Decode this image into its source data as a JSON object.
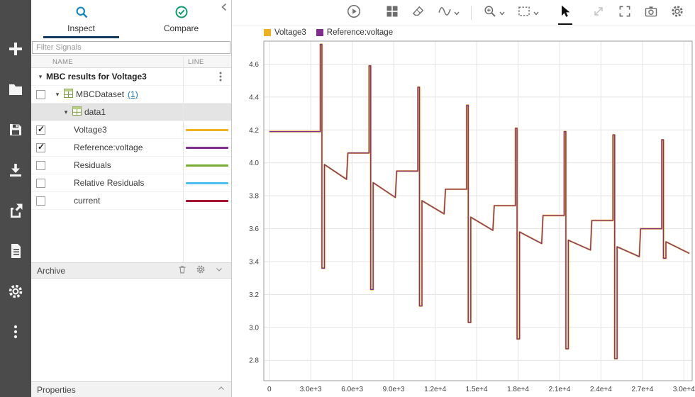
{
  "left_toolbar": {
    "buttons": [
      {
        "label": "new"
      },
      {
        "label": "open"
      },
      {
        "label": "save"
      },
      {
        "label": "import"
      },
      {
        "label": "export"
      },
      {
        "label": "create-report"
      },
      {
        "label": "preferences"
      },
      {
        "label": "more-options"
      }
    ]
  },
  "sidebar": {
    "tabs": [
      {
        "label": "Inspect",
        "selected": true
      },
      {
        "label": "Compare",
        "selected": false
      }
    ],
    "filter_placeholder": "Filter Signals",
    "columns": [
      "NAME",
      "LINE"
    ],
    "tree": {
      "group_label": "MBC results for Voltage3",
      "dataset_label": "MBCDataset",
      "dataset_count_link": "(1)",
      "run_label": "data1",
      "signals": [
        {
          "name": "Voltage3",
          "checked": true,
          "color": "#EDB120"
        },
        {
          "name": "Reference:voltage",
          "checked": true,
          "color": "#7E2F8E"
        },
        {
          "name": "Residuals",
          "checked": false,
          "color": "#77AC30"
        },
        {
          "name": "Relative Residuals",
          "checked": false,
          "color": "#4DBEEE"
        },
        {
          "name": "current",
          "checked": false,
          "color": "#A2142F"
        }
      ]
    },
    "archive_label": "Archive",
    "properties_label": "Properties"
  },
  "accent_colors": {
    "inspect_icon_blue": "#1786c0",
    "compare_icon_green": "#0f9d6a",
    "tab_underline": "#15395b"
  },
  "chart_data": {
    "type": "line",
    "title": "",
    "xlabel": "",
    "ylabel": "",
    "grid": true,
    "legend_position": "top-left",
    "xlim": [
      -400,
      30600
    ],
    "ylim": [
      2.676,
      4.74
    ],
    "x_ticks": [
      0,
      3000,
      6000,
      9000,
      12000,
      15000,
      18000,
      21000,
      24000,
      27000,
      30000
    ],
    "x_tick_labels": [
      "0",
      "3.0e+3",
      "6.0e+3",
      "9.0e+3",
      "1.2e+4",
      "1.5e+4",
      "1.8e+4",
      "2.1e+4",
      "2.4e+4",
      "2.7e+4",
      "3.0e+4"
    ],
    "y_ticks": [
      2.8,
      3.0,
      3.2,
      3.4,
      3.6,
      3.8,
      4.0,
      4.2,
      4.4,
      4.6
    ],
    "y_tick_labels": [
      "2.8",
      "3.0",
      "3.2",
      "3.4",
      "3.6",
      "3.8",
      "4.0",
      "4.2",
      "4.4",
      "4.6"
    ],
    "legend": [
      {
        "name": "Voltage3",
        "color": "#EDB120"
      },
      {
        "name": "Reference:voltage",
        "color": "#7E2F8E"
      }
    ],
    "series": [
      {
        "name": "Voltage3",
        "color": "#EDB120",
        "points": [
          [
            0,
            4.19
          ],
          [
            3686,
            4.19
          ],
          [
            3686,
            4.72
          ],
          [
            3806,
            4.72
          ],
          [
            3806,
            3.36
          ],
          [
            3986,
            3.36
          ],
          [
            3986,
            3.99
          ],
          [
            5586,
            3.9
          ],
          [
            5686,
            4.06
          ],
          [
            7216,
            4.06
          ],
          [
            7216,
            4.59
          ],
          [
            7336,
            4.59
          ],
          [
            7336,
            3.23
          ],
          [
            7516,
            3.23
          ],
          [
            7516,
            3.88
          ],
          [
            9116,
            3.79
          ],
          [
            9216,
            3.95
          ],
          [
            10747,
            3.95
          ],
          [
            10747,
            4.46
          ],
          [
            10867,
            4.46
          ],
          [
            10867,
            3.13
          ],
          [
            11047,
            3.13
          ],
          [
            11047,
            3.77
          ],
          [
            12647,
            3.69
          ],
          [
            12747,
            3.84
          ],
          [
            14277,
            3.84
          ],
          [
            14277,
            4.35
          ],
          [
            14397,
            4.35
          ],
          [
            14397,
            3.03
          ],
          [
            14577,
            3.03
          ],
          [
            14577,
            3.67
          ],
          [
            16177,
            3.59
          ],
          [
            16277,
            3.74
          ],
          [
            17808,
            3.74
          ],
          [
            17808,
            4.21
          ],
          [
            17928,
            4.21
          ],
          [
            17928,
            2.93
          ],
          [
            18108,
            2.93
          ],
          [
            18108,
            3.58
          ],
          [
            19708,
            3.51
          ],
          [
            19808,
            3.68
          ],
          [
            21338,
            3.68
          ],
          [
            21338,
            4.19
          ],
          [
            21458,
            4.19
          ],
          [
            21458,
            2.87
          ],
          [
            21638,
            2.87
          ],
          [
            21638,
            3.53
          ],
          [
            23238,
            3.47
          ],
          [
            23338,
            3.65
          ],
          [
            24869,
            3.65
          ],
          [
            24869,
            4.17
          ],
          [
            24989,
            4.17
          ],
          [
            24989,
            2.81
          ],
          [
            25169,
            2.81
          ],
          [
            25169,
            3.49
          ],
          [
            26769,
            3.43
          ],
          [
            26869,
            3.6
          ],
          [
            28399,
            3.6
          ],
          [
            28399,
            4.14
          ],
          [
            28519,
            4.14
          ],
          [
            28519,
            3.42
          ],
          [
            28699,
            3.42
          ],
          [
            28699,
            3.52
          ],
          [
            30400,
            3.45
          ]
        ]
      },
      {
        "name": "Reference:voltage",
        "color": "#7E2F8E",
        "points": [
          [
            0,
            4.19
          ],
          [
            3686,
            4.19
          ],
          [
            3686,
            4.72
          ],
          [
            3806,
            4.72
          ],
          [
            3806,
            3.36
          ],
          [
            3986,
            3.36
          ],
          [
            3986,
            3.99
          ],
          [
            5586,
            3.9
          ],
          [
            5686,
            4.06
          ],
          [
            7216,
            4.06
          ],
          [
            7216,
            4.59
          ],
          [
            7336,
            4.59
          ],
          [
            7336,
            3.23
          ],
          [
            7516,
            3.23
          ],
          [
            7516,
            3.88
          ],
          [
            9116,
            3.79
          ],
          [
            9216,
            3.95
          ],
          [
            10747,
            3.95
          ],
          [
            10747,
            4.46
          ],
          [
            10867,
            4.46
          ],
          [
            10867,
            3.13
          ],
          [
            11047,
            3.13
          ],
          [
            11047,
            3.77
          ],
          [
            12647,
            3.69
          ],
          [
            12747,
            3.84
          ],
          [
            14277,
            3.84
          ],
          [
            14277,
            4.35
          ],
          [
            14397,
            4.35
          ],
          [
            14397,
            3.03
          ],
          [
            14577,
            3.03
          ],
          [
            14577,
            3.67
          ],
          [
            16177,
            3.59
          ],
          [
            16277,
            3.74
          ],
          [
            17808,
            3.74
          ],
          [
            17808,
            4.21
          ],
          [
            17928,
            4.21
          ],
          [
            17928,
            2.93
          ],
          [
            18108,
            2.93
          ],
          [
            18108,
            3.58
          ],
          [
            19708,
            3.51
          ],
          [
            19808,
            3.68
          ],
          [
            21338,
            3.68
          ],
          [
            21338,
            4.19
          ],
          [
            21458,
            4.19
          ],
          [
            21458,
            2.87
          ],
          [
            21638,
            2.87
          ],
          [
            21638,
            3.53
          ],
          [
            23238,
            3.47
          ],
          [
            23338,
            3.65
          ],
          [
            24869,
            3.65
          ],
          [
            24869,
            4.17
          ],
          [
            24989,
            4.17
          ],
          [
            24989,
            2.81
          ],
          [
            25169,
            2.81
          ],
          [
            25169,
            3.49
          ],
          [
            26769,
            3.43
          ],
          [
            26869,
            3.6
          ],
          [
            28399,
            3.6
          ],
          [
            28399,
            4.14
          ],
          [
            28519,
            4.14
          ],
          [
            28519,
            3.42
          ],
          [
            28699,
            3.42
          ],
          [
            28699,
            3.52
          ],
          [
            30400,
            3.45
          ]
        ]
      }
    ]
  }
}
